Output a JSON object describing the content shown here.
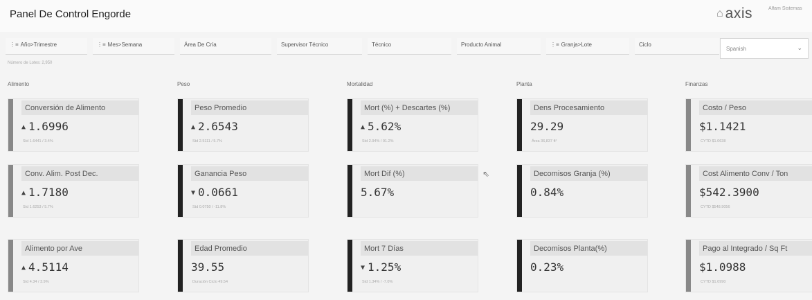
{
  "header": {
    "title": "Panel De Control Engorde",
    "brand": "axis",
    "brand_icon": "house-logo-icon",
    "user": "Alfam Sistemas"
  },
  "filters": [
    {
      "label": "Año>Trimestre",
      "icon": "hierarchy-icon"
    },
    {
      "label": "Mes>Semana",
      "icon": "hierarchy-icon"
    },
    {
      "label": "Área De Cría",
      "icon": ""
    },
    {
      "label": "Supervisor Técnico",
      "icon": ""
    },
    {
      "label": "Técnico",
      "icon": ""
    },
    {
      "label": "Producto Animal",
      "icon": ""
    },
    {
      "label": "Granja>Lote",
      "icon": "hierarchy-icon"
    },
    {
      "label": "Ciclo",
      "icon": ""
    }
  ],
  "language": {
    "value": "Spanish"
  },
  "note": "Número de Lotes: 2,950",
  "sections": [
    {
      "title": "Alimento",
      "cards": [
        {
          "label": "Conversión de Alimento",
          "value": "1.6996",
          "trend": "up",
          "foot": "Std 1.6441 / 3.4%"
        },
        {
          "label": "Conv. Alim. Post Dec.",
          "value": "1.7180",
          "trend": "up",
          "foot": "Std 1.6253 / 5.7%"
        },
        {
          "label": "Alimento por Ave",
          "value": "4.5114",
          "trend": "up",
          "foot": "Std 4.34 / 3.9%"
        }
      ]
    },
    {
      "title": "Peso",
      "cards": [
        {
          "label": "Peso Promedio",
          "value": "2.6543",
          "trend": "up",
          "foot": "Std 2.5111 / 5.7%"
        },
        {
          "label": "Ganancia Peso",
          "value": "0.0661",
          "trend": "down",
          "foot": "Std 0.0750 / -11.8%"
        },
        {
          "label": "Edad Promedio",
          "value": "39.55",
          "trend": "",
          "foot": "Duración Ciclo 49.54"
        }
      ]
    },
    {
      "title": "Mortalidad",
      "cards": [
        {
          "label": "Mort (%) + Descartes (%)",
          "value": "5.62%",
          "trend": "up",
          "foot": "Std 2.94% / 91.2%"
        },
        {
          "label": "Mort Dif (%)",
          "value": "5.67%",
          "trend": "",
          "foot": ""
        },
        {
          "label": "Mort 7 Días",
          "value": "1.25%",
          "trend": "down",
          "foot": "Std 1.34% / -7.0%"
        }
      ]
    },
    {
      "title": "Planta",
      "cards": [
        {
          "label": "Dens Procesamiento",
          "value": "29.29",
          "trend": "",
          "foot": "Área 36,837 ft²"
        },
        {
          "label": "Decomisos Granja (%)",
          "value": "0.84%",
          "trend": "",
          "foot": ""
        },
        {
          "label": "Decomisos Planta(%)",
          "value": "0.23%",
          "trend": "",
          "foot": ""
        }
      ]
    },
    {
      "title": "Finanzas",
      "cards": [
        {
          "label": "Costo / Peso",
          "value": "$1.1421",
          "trend": "",
          "foot": "CYTD $1.0638"
        },
        {
          "label": "Cost Alimento Conv / Ton",
          "value": "$542.3900",
          "trend": "",
          "foot": "CYTD $548.9056"
        },
        {
          "label": "Pago al Integrado / Sq Ft",
          "value": "$1.0988",
          "trend": "",
          "foot": "CYTD $1.0990"
        }
      ]
    }
  ],
  "colors": {
    "accent_bar": "#222222",
    "muted_bar": "#888888"
  }
}
